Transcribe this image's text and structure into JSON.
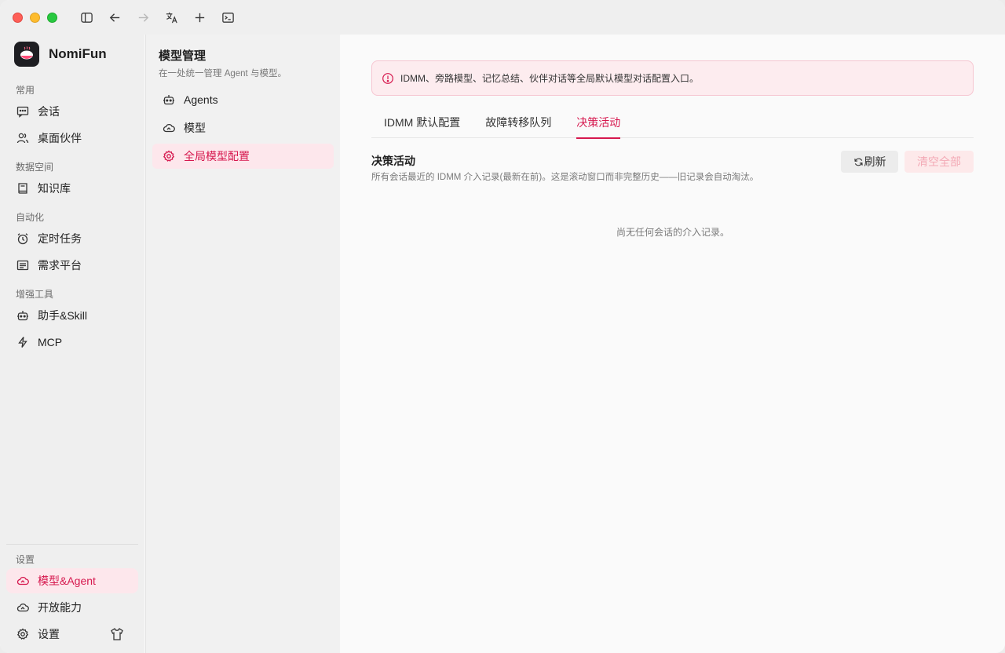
{
  "window": {
    "toolbar": {
      "icons": [
        "sidebar-toggle-icon",
        "arrow-left-icon",
        "arrow-right-icon",
        "translate-icon",
        "plus-icon",
        "terminal-icon"
      ]
    }
  },
  "sidebar": {
    "brand": {
      "name": "NomiFun"
    },
    "groups": [
      {
        "label": "常用",
        "items": [
          {
            "label": "会话",
            "icon": "chat-icon"
          },
          {
            "label": "桌面伙伴",
            "icon": "users-icon"
          }
        ]
      },
      {
        "label": "数据空间",
        "items": [
          {
            "label": "知识库",
            "icon": "book-icon"
          }
        ]
      },
      {
        "label": "自动化",
        "items": [
          {
            "label": "定时任务",
            "icon": "alarm-clock-icon"
          },
          {
            "label": "需求平台",
            "icon": "list-icon"
          }
        ]
      },
      {
        "label": "增强工具",
        "items": [
          {
            "label": "助手&Skill",
            "icon": "robot-icon"
          },
          {
            "label": "MCP",
            "icon": "lightning-icon"
          }
        ]
      }
    ],
    "bottom": {
      "label": "设置",
      "items": [
        {
          "label": "模型&Agent",
          "icon": "cloud-icon",
          "active": true
        },
        {
          "label": "开放能力",
          "icon": "cloud-icon"
        },
        {
          "label": "设置",
          "icon": "gear-icon"
        }
      ]
    }
  },
  "panel": {
    "title": "模型管理",
    "subtitle": "在一处统一管理 Agent 与模型。",
    "items": [
      {
        "label": "Agents",
        "icon": "robot-icon"
      },
      {
        "label": "模型",
        "icon": "cloud-icon"
      },
      {
        "label": "全局模型配置",
        "icon": "gear-icon",
        "active": true
      }
    ]
  },
  "main": {
    "alert": "IDMM、旁路模型、记忆总结、伙伴对话等全局默认模型对话配置入口。",
    "tabs": [
      "IDMM 默认配置",
      "故障转移队列",
      "决策活动"
    ],
    "active_tab": "决策活动",
    "section": {
      "title": "决策活动",
      "description": "所有会话最近的 IDMM 介入记录(最新在前)。这是滚动窗口而非完整历史——旧记录会自动淘汰。"
    },
    "buttons": {
      "refresh": "刷新",
      "clear_all": "清空全部"
    },
    "empty_text": "尚无任何会话的介入记录。"
  },
  "colors": {
    "accent": "#d6184e",
    "active_bg": "#fde7ec"
  }
}
